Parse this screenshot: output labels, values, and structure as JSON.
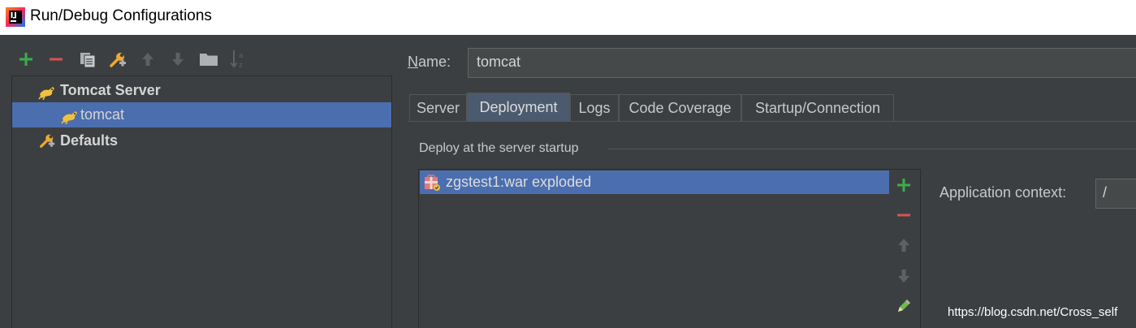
{
  "window": {
    "title": "Run/Debug Configurations"
  },
  "toolbar": {
    "buttons": [
      "add-icon",
      "remove-icon",
      "copy-icon",
      "edit-defaults-icon",
      "move-up-icon",
      "move-down-icon",
      "folder-icon",
      "sort-icon"
    ]
  },
  "tree": {
    "group_label": "Tomcat Server",
    "child_label": "tomcat",
    "defaults_label": "Defaults"
  },
  "name_field": {
    "label_first": "N",
    "label_rest": "ame:",
    "value": "tomcat"
  },
  "tabs": [
    "Server",
    "Deployment",
    "Logs",
    "Code Coverage",
    "Startup/Connection"
  ],
  "active_tab": "Deployment",
  "deployment": {
    "section_label": "Deploy at the server startup",
    "artifacts": [
      "zgstest1:war exploded"
    ],
    "context_label": "Application context:",
    "context_value": "/"
  },
  "watermark": "https://blog.csdn.net/Cross_self",
  "colors": {
    "accent": "#4b6eaf",
    "background": "#3c3f41",
    "add": "#3cae4b",
    "remove": "#d9534f"
  }
}
